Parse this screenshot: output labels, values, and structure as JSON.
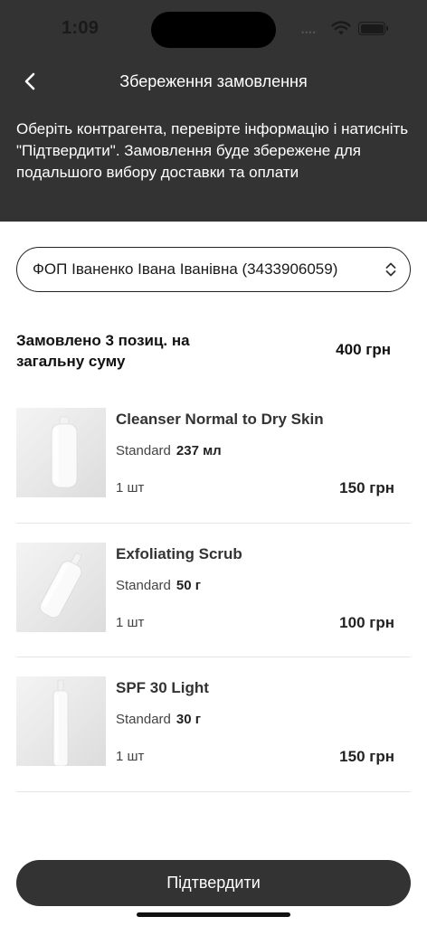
{
  "status_bar": {
    "time": "1:09",
    "signal": "••••"
  },
  "nav": {
    "title": "Збереження замовлення",
    "back_icon": "chevron-left-icon"
  },
  "instructions": "Оберіть контрагента, перевірте інформацію і натисніть \"Підтвердити\". Замовлення буде збережене для подальшого вибору доставки та оплати",
  "counterparty": {
    "selected": "ФОП Іваненко Івана Іванівна (3433906059)",
    "icon": "chevron-up-down-icon"
  },
  "summary": {
    "label": "Замовлено 3 позиц. на загальну суму",
    "total": "400 грн"
  },
  "items": [
    {
      "name": "Cleanser Normal to Dry Skin",
      "variant": "Standard",
      "volume": "237 мл",
      "qty": "1 шт",
      "price": "150 грн"
    },
    {
      "name": "Exfoliating Scrub",
      "variant": "Standard",
      "volume": "50 г",
      "qty": "1 шт",
      "price": "100 грн"
    },
    {
      "name": "SPF 30 Light",
      "variant": "Standard",
      "volume": "30 г",
      "qty": "1 шт",
      "price": "150 грн"
    }
  ],
  "confirm_button": "Підтвердити",
  "colors": {
    "header_bg": "#333333",
    "button_bg": "#333333",
    "text_dark": "#1a1a1a"
  }
}
